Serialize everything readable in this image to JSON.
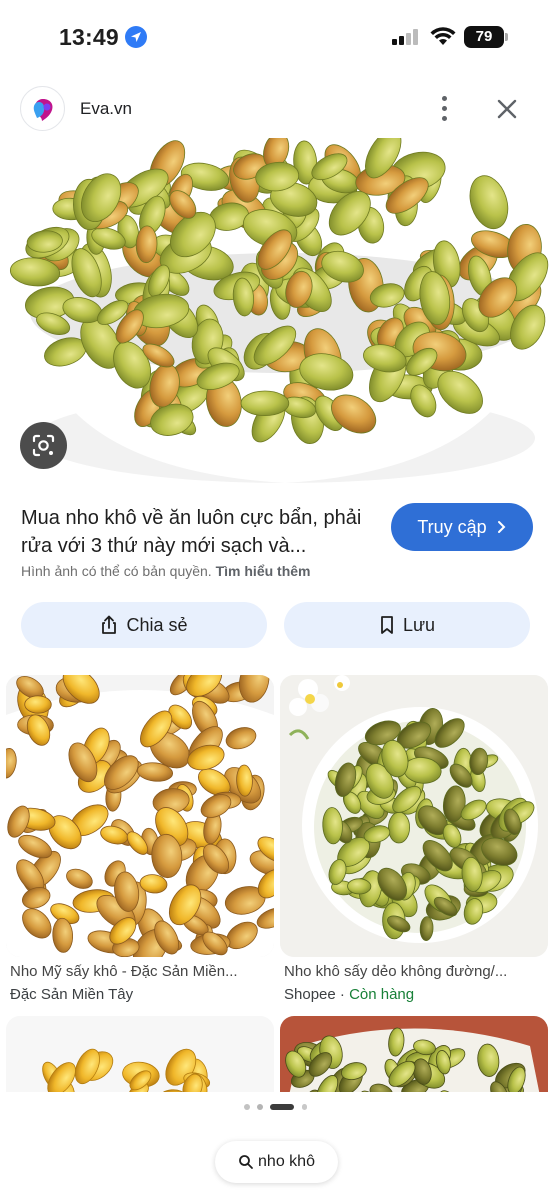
{
  "status_bar": {
    "time": "13:49",
    "battery": "79"
  },
  "source": {
    "name": "Eva.vn",
    "logo_icon": "eva-logo-icon",
    "more_icon": "more-vertical-icon",
    "close_icon": "close-icon"
  },
  "result": {
    "title": "Mua nho khô về ăn luôn cực bẩn, phải rửa với 3 thứ này mới sạch và...",
    "visit_label": "Truy cập",
    "copyright_text": "Hình ảnh có thể có bản quyền.",
    "learn_more": "Tìm hiểu thêm"
  },
  "actions": {
    "share_label": "Chia sẻ",
    "save_label": "Lưu"
  },
  "related": [
    {
      "caption": "Nho Mỹ sấy khô - Đặc Sản Miền...",
      "source": "Đặc Sản Miền Tây",
      "status": ""
    },
    {
      "caption": "Nho khô sấy dẻo không đường/...",
      "source": "Shopee",
      "status": "Còn hàng"
    }
  ],
  "search": {
    "query": "nho khô"
  },
  "colors": {
    "accent": "#2f6fd6",
    "chip_bg": "#e8f0fd",
    "in_stock": "#188038"
  }
}
